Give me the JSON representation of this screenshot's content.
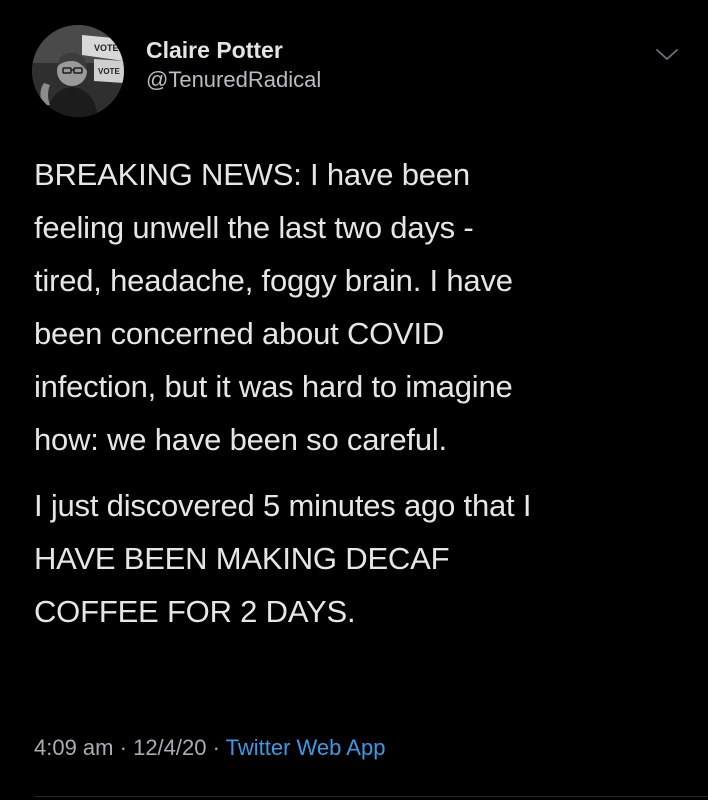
{
  "tweet": {
    "author": {
      "display_name": "Claire Potter",
      "handle": "@TenuredRadical",
      "avatar_sign_text_1": "VOTE",
      "avatar_sign_text_2": "VOTE"
    },
    "paragraphs": [
      {
        "lines": [
          "BREAKING NEWS: I have been",
          "feeling unwell the last two days -",
          "tired, headache, foggy brain. I have",
          "been concerned about COVID",
          "infection, but it was hard to imagine",
          "how: we have been so careful."
        ]
      },
      {
        "lines": [
          "I just discovered 5 minutes ago that I",
          "HAVE BEEN MAKING DECAF",
          "COFFEE FOR 2 DAYS."
        ]
      }
    ],
    "meta": {
      "time": "4:09 am",
      "separator": "·",
      "date": "12/4/20",
      "source": "Twitter Web App"
    },
    "menu_icon": "chevron-down-icon",
    "colors": {
      "background": "#000000",
      "text": "#e6e6e6",
      "link": "#3a9ae8",
      "muted": "#a9aeb3"
    }
  }
}
